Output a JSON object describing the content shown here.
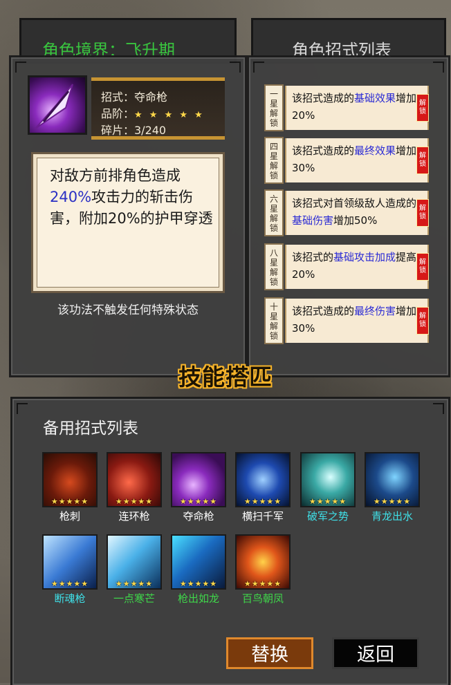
{
  "background_titles": {
    "realm_label": "角色境界：飞升期",
    "moves_header": "角色招式列表"
  },
  "skill": {
    "name_label": "招式：夺命枪",
    "grade_label": "品阶：",
    "grade_stars": "★ ★ ★ ★ ★",
    "fragments_label": "碎片：3/240",
    "desc_before": "对敌方前排角色造成",
    "desc_highlight": "240%",
    "desc_after": "攻击力的斩击伤害，附加20%的护甲穿透",
    "status_note": "该功法不触发任何特殊状态"
  },
  "unlocks": [
    {
      "tag": "一星解锁",
      "pre": "该招式造成的",
      "hl": "基础效果",
      "post": "增加20%",
      "lock": "解锁"
    },
    {
      "tag": "四星解锁",
      "pre": "该招式造成的",
      "hl": "最终效果",
      "post": "增加30%",
      "lock": "解锁"
    },
    {
      "tag": "六星解锁",
      "pre": "该招式对首领级敌人造成的",
      "hl": "基础伤害",
      "post": "增加50%",
      "lock": "解锁"
    },
    {
      "tag": "八星解锁",
      "pre": "该招式的",
      "hl": "基础攻击加成",
      "post": "提高20%",
      "lock": "解锁"
    },
    {
      "tag": "十星解锁",
      "pre": "该招式造成的",
      "hl": "最终伤害",
      "post": "增加30%",
      "lock": "解锁"
    }
  ],
  "section_title": "技能搭匹",
  "backup": {
    "header": "备用招式列表",
    "items": [
      {
        "name": "枪刺",
        "stars": "★★★★★",
        "name_color": "#ffffff"
      },
      {
        "name": "连环枪",
        "stars": "★★★★★",
        "name_color": "#ffffff"
      },
      {
        "name": "夺命枪",
        "stars": "★★★★★",
        "name_color": "#ffffff"
      },
      {
        "name": "横扫千军",
        "stars": "★★★★★",
        "name_color": "#ffffff"
      },
      {
        "name": "破军之势",
        "stars": "★★★★★",
        "name_color": "#3fe0e8"
      },
      {
        "name": "青龙出水",
        "stars": "★★★★★",
        "name_color": "#3fe0e8"
      },
      {
        "name": "断魂枪",
        "stars": "★★★★★",
        "name_color": "#3fe0e8"
      },
      {
        "name": "一点寒芒",
        "stars": "★★★★★",
        "name_color": "#3fd64a"
      },
      {
        "name": "枪出如龙",
        "stars": "★★★★★",
        "name_color": "#3fd64a"
      },
      {
        "name": "百鸟朝凤",
        "stars": "★★★★★",
        "name_color": "#3fd64a"
      }
    ]
  },
  "buttons": {
    "replace": "替换",
    "back": "返回"
  },
  "colors": {
    "gold": "#c79433",
    "highlight_blue": "#2b30c4",
    "lock_red": "#d61818"
  }
}
